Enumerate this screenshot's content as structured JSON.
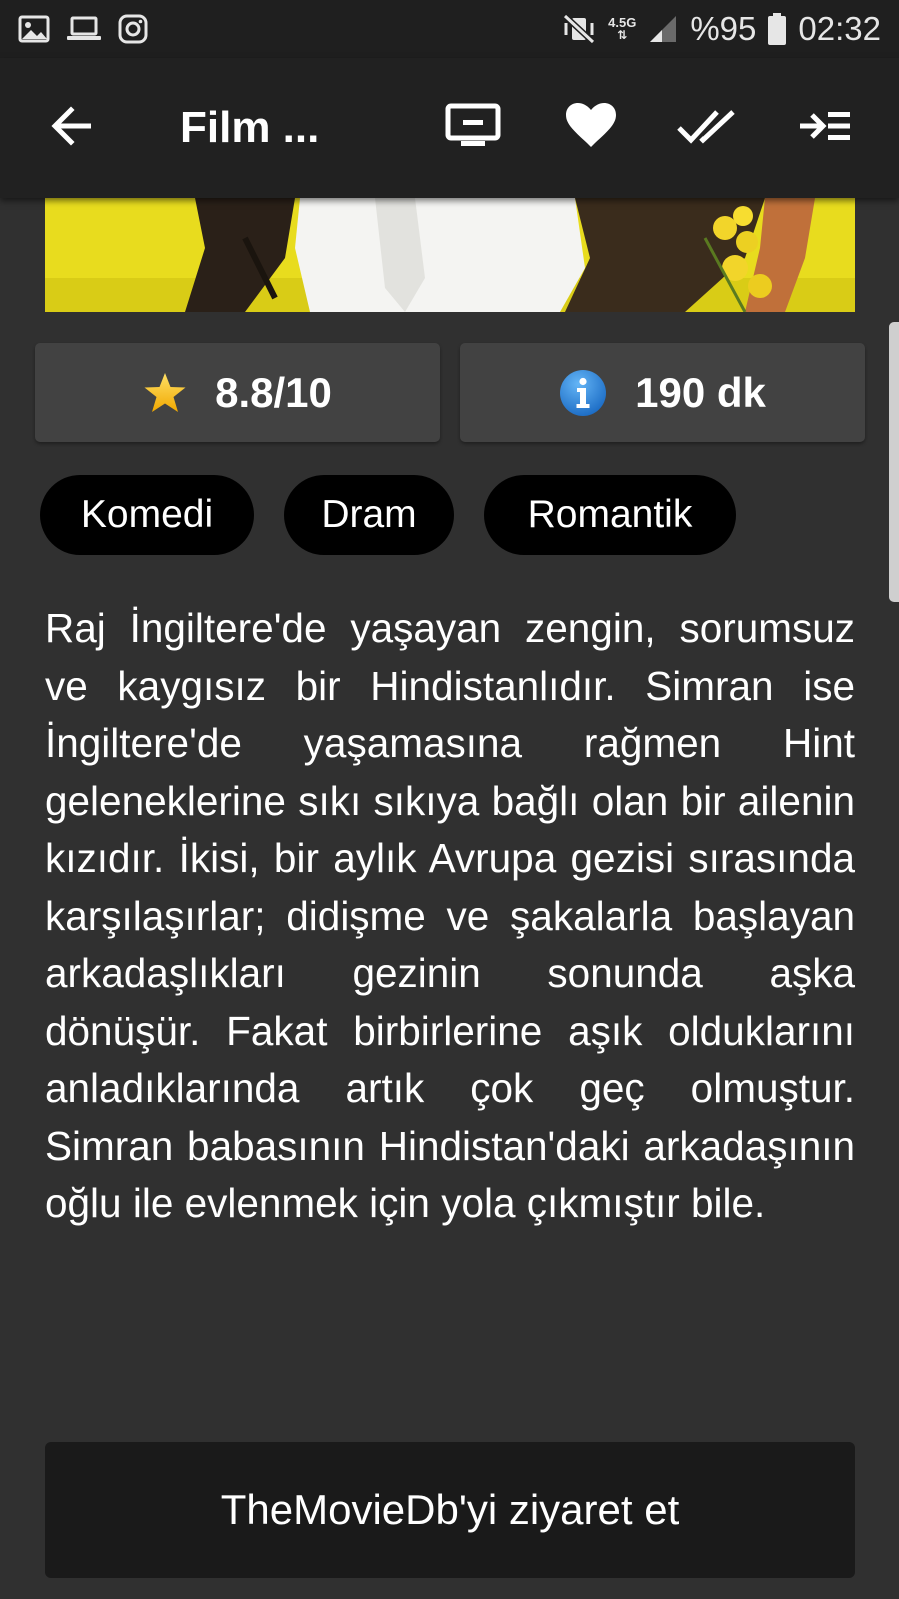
{
  "status_bar": {
    "network_type": "4.5G",
    "battery": "%95",
    "time": "02:32",
    "left_icons": [
      "gallery-icon",
      "laptop-icon",
      "instagram-icon"
    ],
    "right_icons": [
      "vibrate-mute-icon",
      "signal-icon",
      "battery-icon"
    ]
  },
  "toolbar": {
    "title": "Film ...",
    "actions": [
      "tv-icon",
      "heart-icon",
      "double-check-icon",
      "add-to-list-icon"
    ]
  },
  "movie": {
    "rating": "8.8/10",
    "runtime": "190 dk",
    "genres": [
      "Komedi",
      "Dram",
      "Romantik"
    ],
    "overview": "Raj İngiltere'de yaşayan zengin, sorumsuz ve kaygısız bir Hindistanlıdır. Simran ise İngiltere'de yaşamasına rağmen Hint geleneklerine sıkı sıkıya bağlı olan bir ailenin kızıdır. İkisi, bir aylık Avrupa gezisi sırasında karşılaşırlar; didişme ve şakalarla başlayan arkadaşlıkları gezinin sonunda aşka dönüşür. Fakat birbirlerine aşık olduklarını anladıklarında artık çok geç olmuştur. Simran babasının Hindistan'daki arkadaşının oğlu ile evlenmek için yola çıkmıştır bile."
  },
  "visit_button": {
    "label": "TheMovieDb'yi ziyaret et"
  },
  "colors": {
    "background": "#303030",
    "toolbar": "#212121",
    "card": "#424242",
    "chip": "#000000",
    "star": "#f5c518",
    "info": "#1e88e5"
  }
}
